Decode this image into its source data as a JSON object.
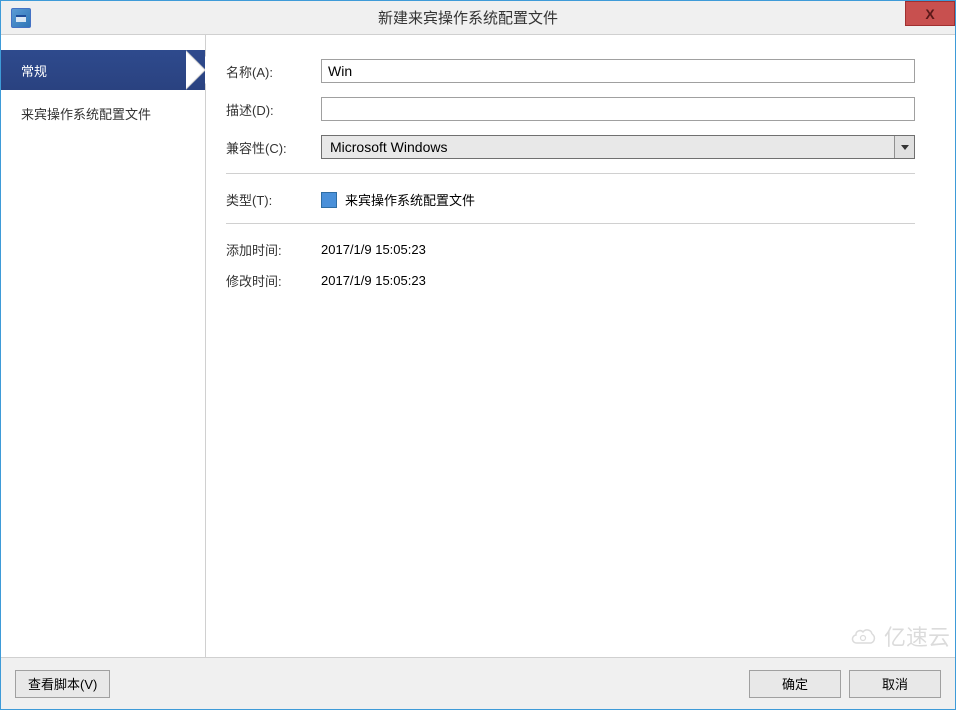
{
  "titlebar": {
    "title": "新建来宾操作系统配置文件",
    "close": "X"
  },
  "sidebar": {
    "selected": "常规",
    "items": [
      {
        "label": "来宾操作系统配置文件"
      }
    ]
  },
  "form": {
    "name_label": "名称(A):",
    "name_value": "Win",
    "desc_label": "描述(D):",
    "desc_value": "",
    "compat_label": "兼容性(C):",
    "compat_value": "Microsoft Windows",
    "type_label": "类型(T):",
    "type_value": "来宾操作系统配置文件",
    "added_label": "添加时间:",
    "added_value": "2017/1/9 15:05:23",
    "modified_label": "修改时间:",
    "modified_value": "2017/1/9 15:05:23"
  },
  "footer": {
    "view_script": "查看脚本(V)",
    "ok": "确定",
    "cancel": "取消"
  },
  "watermark": "亿速云"
}
